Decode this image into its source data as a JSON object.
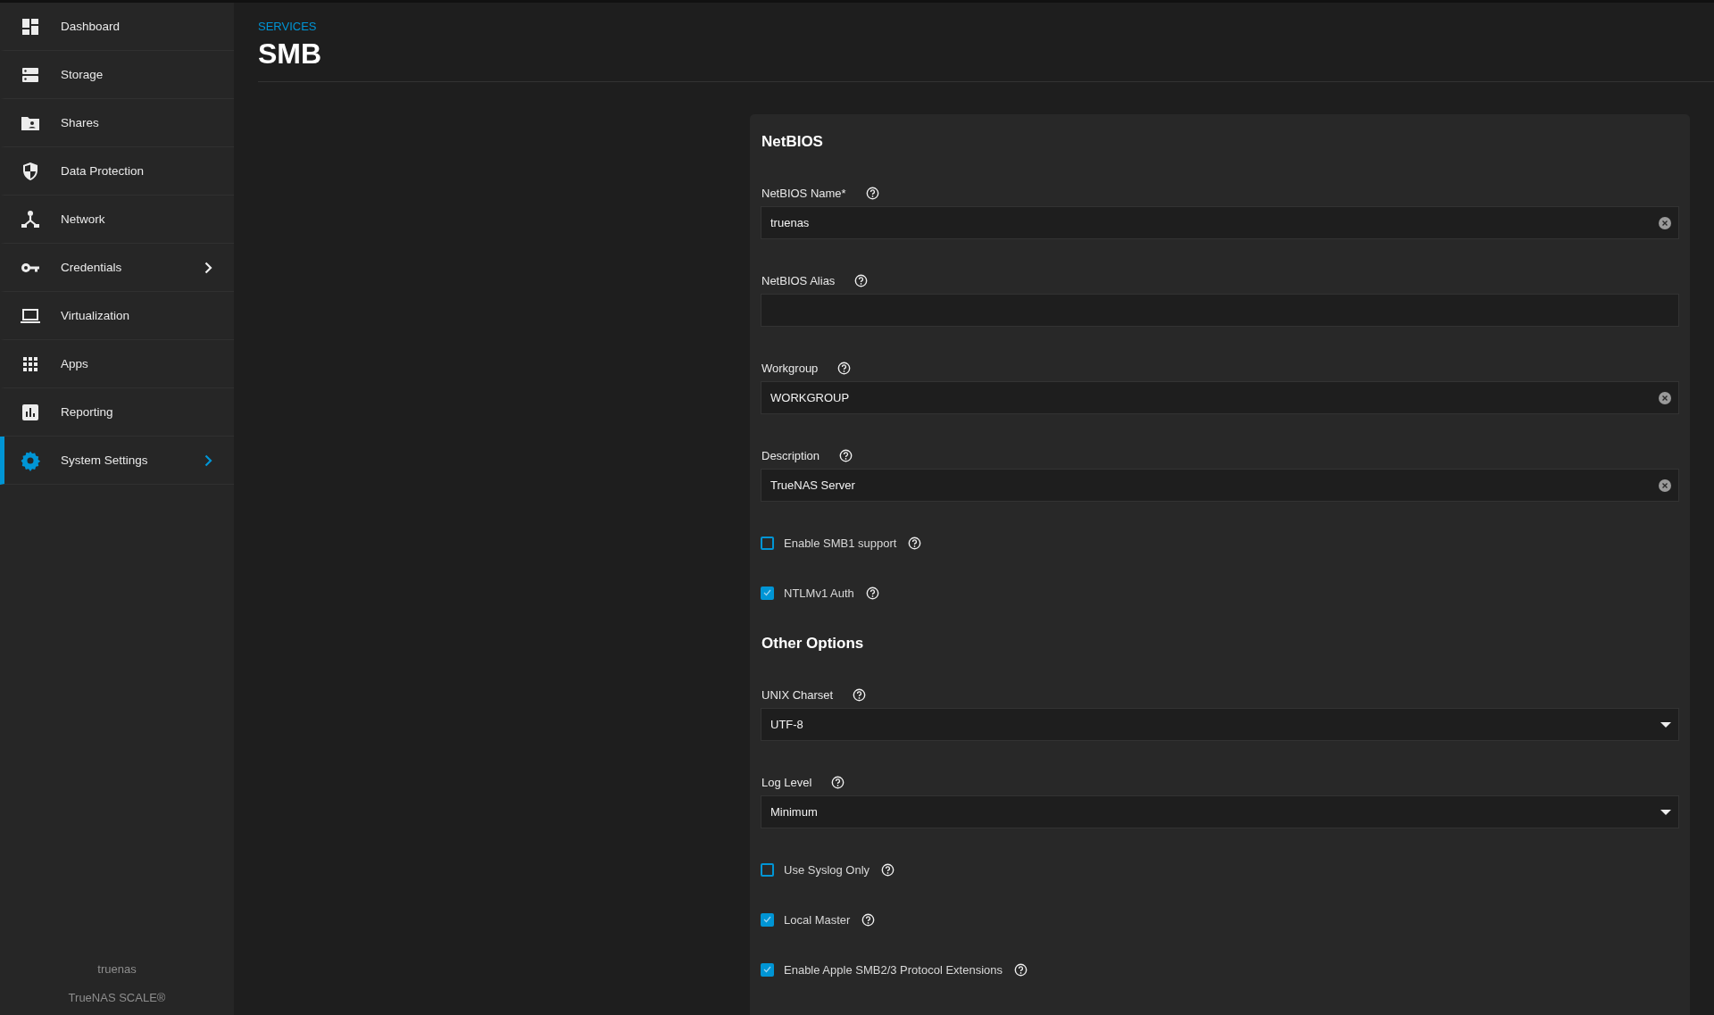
{
  "sidebar": {
    "items": [
      {
        "label": "Dashboard",
        "selected": false,
        "expandable": false
      },
      {
        "label": "Storage",
        "selected": false,
        "expandable": false
      },
      {
        "label": "Shares",
        "selected": false,
        "expandable": false
      },
      {
        "label": "Data Protection",
        "selected": false,
        "expandable": false
      },
      {
        "label": "Network",
        "selected": false,
        "expandable": false
      },
      {
        "label": "Credentials",
        "selected": false,
        "expandable": true
      },
      {
        "label": "Virtualization",
        "selected": false,
        "expandable": false
      },
      {
        "label": "Apps",
        "selected": false,
        "expandable": false
      },
      {
        "label": "Reporting",
        "selected": false,
        "expandable": false
      },
      {
        "label": "System Settings",
        "selected": true,
        "expandable": true
      }
    ],
    "hostname": "truenas",
    "product": "TrueNAS SCALE®"
  },
  "header": {
    "breadcrumb": "SERVICES",
    "title": "SMB"
  },
  "form": {
    "sections": [
      {
        "title": "NetBIOS",
        "fields": [
          {
            "kind": "text",
            "label": "NetBIOS Name*",
            "value": "truenas",
            "clearable": true
          },
          {
            "kind": "text",
            "label": "NetBIOS Alias",
            "clearable": false
          },
          {
            "kind": "text",
            "label": "Workgroup",
            "value": "WORKGROUP",
            "clearable": true
          },
          {
            "kind": "text",
            "label": "Description",
            "value": "TrueNAS Server",
            "clearable": true
          },
          {
            "kind": "checkbox",
            "label": "Enable SMB1 support",
            "checked": false
          },
          {
            "kind": "checkbox",
            "label": "NTLMv1 Auth",
            "checked": true
          }
        ]
      },
      {
        "title": "Other Options",
        "fields": [
          {
            "kind": "select",
            "label": "UNIX Charset",
            "value": "UTF-8"
          },
          {
            "kind": "select",
            "label": "Log Level",
            "value": "Minimum"
          },
          {
            "kind": "checkbox",
            "label": "Use Syslog Only",
            "checked": false
          },
          {
            "kind": "checkbox",
            "label": "Local Master",
            "checked": true
          },
          {
            "kind": "checkbox",
            "label": "Enable Apple SMB2/3 Protocol Extensions",
            "checked": true
          }
        ]
      }
    ]
  }
}
